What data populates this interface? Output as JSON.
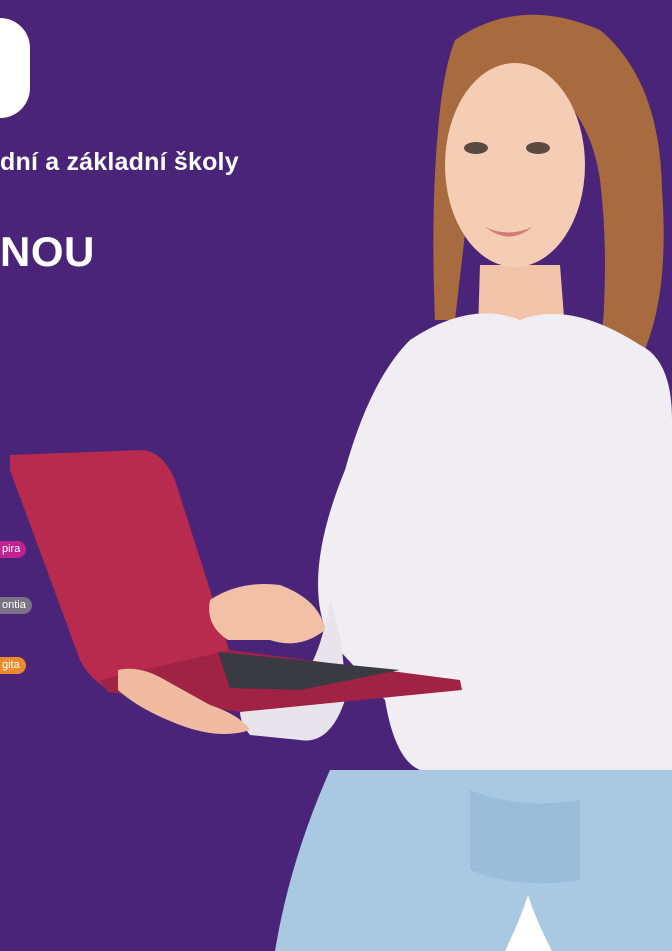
{
  "brand": {
    "logo_icon": "logo-mark",
    "colors": {
      "background": "#4a2478",
      "text": "#ffffff",
      "pill_pink": "#c0238f",
      "pill_gray": "#7b7385",
      "pill_orange": "#ef8a2a"
    }
  },
  "hero": {
    "subtitle": "dní a základní školy",
    "headline": "NOU"
  },
  "pills": [
    {
      "label": "pira"
    },
    {
      "label": "ontia"
    },
    {
      "label": "gita"
    }
  ]
}
